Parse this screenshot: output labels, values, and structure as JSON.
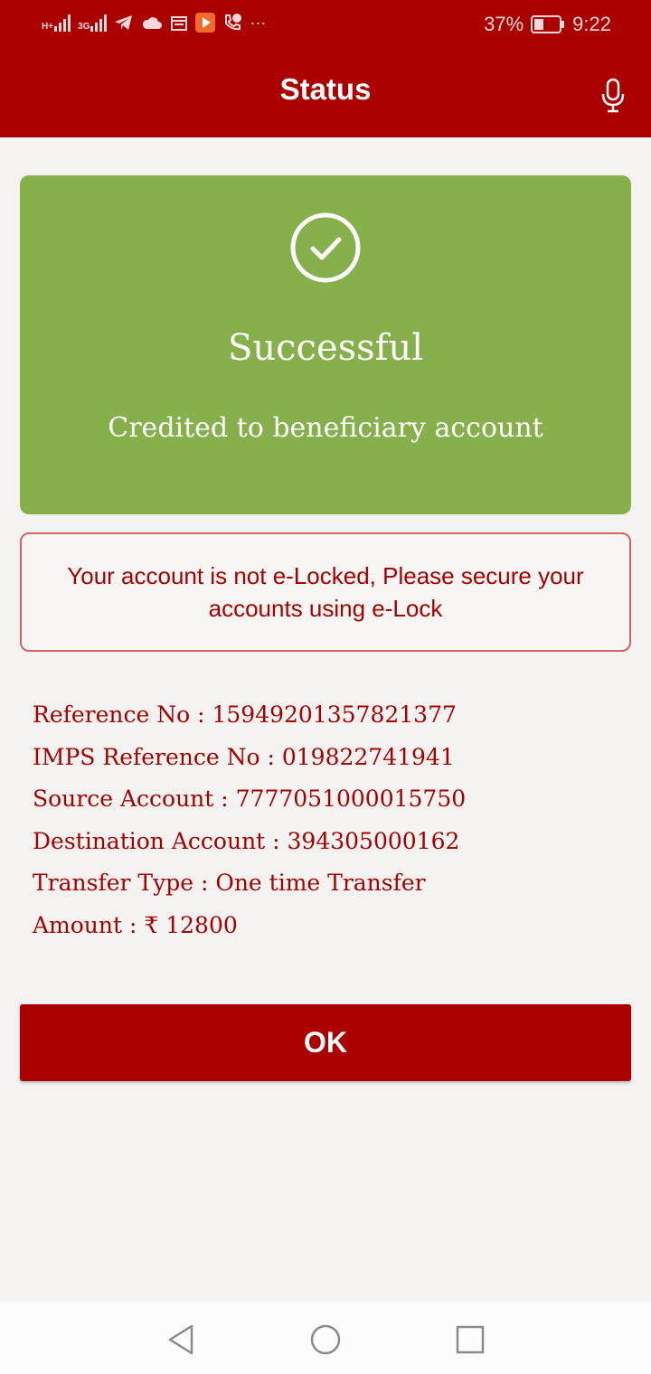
{
  "status_bar": {
    "network_left": "H+",
    "network_right": "3G",
    "battery_percent": "37%",
    "battery_level": 0.37,
    "time": "9:22",
    "more": "···",
    "icons": [
      "signal-icon",
      "telegram-icon",
      "cloud-icon",
      "calendar-icon",
      "play-icon",
      "call-icon",
      "more-icon",
      "battery-icon"
    ]
  },
  "app_bar": {
    "title": "Status",
    "icon": "mic-icon"
  },
  "success": {
    "icon": "check-circle-icon",
    "title": "Successful",
    "subtitle": "Credited to beneficiary account"
  },
  "elock_notice": {
    "text": "Your account is not e-Locked, Please secure your accounts using e-Lock"
  },
  "details": [
    "Reference No : 15949201357821377",
    "IMPS Reference No : 019822741941",
    "Source Account : 7777051000015750",
    "Destination Account : 394305000162",
    "Transfer Type : One time Transfer",
    "Amount : ₹ 12800"
  ],
  "ok_button": {
    "label": "OK"
  },
  "colors": {
    "primary": "#ab0000",
    "success": "#86b04b",
    "background": "#f4f3f1",
    "text_red": "#a80000"
  },
  "nav_bar": {
    "icons": [
      "back-icon",
      "home-icon",
      "recents-icon"
    ]
  }
}
